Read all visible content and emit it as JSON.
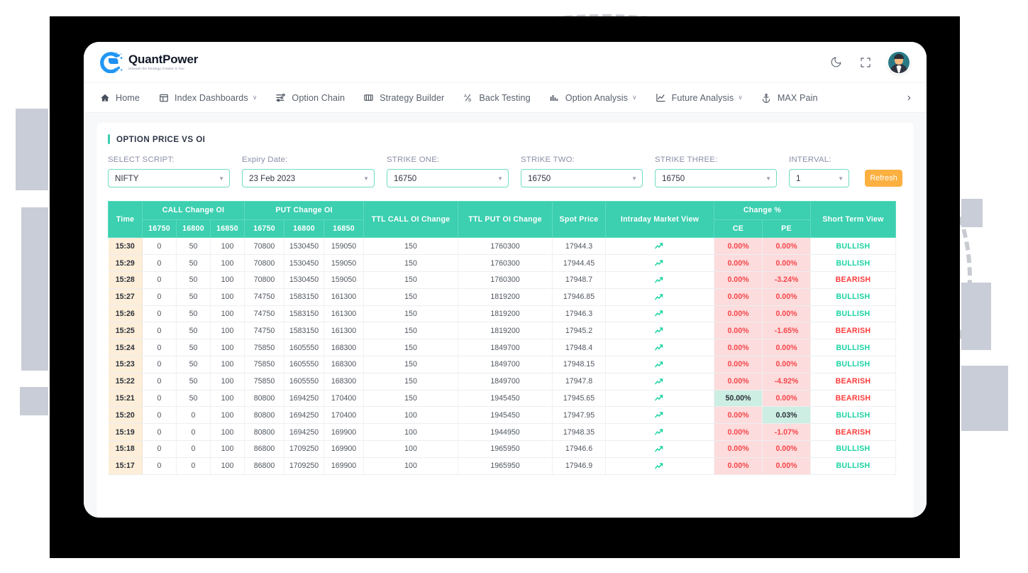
{
  "brand": {
    "name": "QuantPower",
    "tagline": "Unleash the Strategy Creator in You"
  },
  "top_actions": [
    {
      "name": "dark-mode-toggle",
      "icon": "moon-icon"
    },
    {
      "name": "fullscreen-button",
      "icon": "fullscreen-icon"
    },
    {
      "name": "user-avatar",
      "icon": "avatar-icon"
    }
  ],
  "nav": {
    "items": [
      {
        "label": "Home",
        "icon": "home-icon",
        "caret": ""
      },
      {
        "label": "Index Dashboards",
        "icon": "dashboard-icon",
        "caret": "∨"
      },
      {
        "label": "Option Chain",
        "icon": "option-chain-icon",
        "caret": ""
      },
      {
        "label": "Strategy Builder",
        "icon": "strategy-icon",
        "caret": ""
      },
      {
        "label": "Back Testing",
        "icon": "backtesting-icon",
        "caret": ""
      },
      {
        "label": "Option Analysis",
        "icon": "bar-chart-icon",
        "caret": "∨"
      },
      {
        "label": "Future Analysis",
        "icon": "line-chart-icon",
        "caret": "∨"
      },
      {
        "label": "MAX Pain",
        "icon": "anchor-icon",
        "caret": ""
      }
    ],
    "more": "›"
  },
  "panel": {
    "title": "OPTION PRICE VS OI",
    "accent_color": "#3ccfb0"
  },
  "filters": {
    "fields": [
      {
        "name": "select-script",
        "label": "SELECT SCRIPT:",
        "value": "NIFTY"
      },
      {
        "name": "expiry-date",
        "label": "Expiry Date:",
        "value": "23 Feb 2023"
      },
      {
        "name": "strike-one",
        "label": "STRIKE ONE:",
        "value": "16750"
      },
      {
        "name": "strike-two",
        "label": "STRIKE TWO:",
        "value": "16750"
      },
      {
        "name": "strike-three",
        "label": "STRIKE THREE:",
        "value": "16750"
      },
      {
        "name": "interval",
        "label": "INTERVAL:",
        "value": "1"
      }
    ],
    "refresh_label": "Refresh",
    "refresh_color": "#fbb040"
  },
  "table": {
    "group_headers": {
      "time": "Time",
      "call_change_oi": "CALL Change OI",
      "put_change_oi": "PUT Change OI",
      "ttl_call_oi_change": "TTL CALL OI Change",
      "ttl_put_oi_change": "TTL PUT OI Change",
      "spot_price": "Spot Price",
      "intraday_market_view": "Intraday Market View",
      "change_pct": "Change %",
      "short_term_view": "Short Term View"
    },
    "sub_headers": {
      "call_strikes": [
        "16750",
        "16800",
        "16850"
      ],
      "put_strikes": [
        "16750",
        "16800",
        "16850"
      ],
      "change_pct": [
        "CE",
        "PE"
      ]
    },
    "rows": [
      {
        "time": "15:30",
        "call": [
          "0",
          "50",
          "100"
        ],
        "put": [
          "70800",
          "1530450",
          "159050"
        ],
        "ttl_call": "150",
        "ttl_put": "1760300",
        "spot": "17944.3",
        "trend": "up",
        "ce": "0.00%",
        "ce_pos": false,
        "pe": "0.00%",
        "pe_pos": false,
        "stv": "BULLISH"
      },
      {
        "time": "15:29",
        "call": [
          "0",
          "50",
          "100"
        ],
        "put": [
          "70800",
          "1530450",
          "159050"
        ],
        "ttl_call": "150",
        "ttl_put": "1760300",
        "spot": "17944.45",
        "trend": "up",
        "ce": "0.00%",
        "ce_pos": false,
        "pe": "0.00%",
        "pe_pos": false,
        "stv": "BULLISH"
      },
      {
        "time": "15:28",
        "call": [
          "0",
          "50",
          "100"
        ],
        "put": [
          "70800",
          "1530450",
          "159050"
        ],
        "ttl_call": "150",
        "ttl_put": "1760300",
        "spot": "17948.7",
        "trend": "up",
        "ce": "0.00%",
        "ce_pos": false,
        "pe": "-3.24%",
        "pe_pos": false,
        "stv": "BEARISH"
      },
      {
        "time": "15:27",
        "call": [
          "0",
          "50",
          "100"
        ],
        "put": [
          "74750",
          "1583150",
          "161300"
        ],
        "ttl_call": "150",
        "ttl_put": "1819200",
        "spot": "17946.85",
        "trend": "up",
        "ce": "0.00%",
        "ce_pos": false,
        "pe": "0.00%",
        "pe_pos": false,
        "stv": "BULLISH"
      },
      {
        "time": "15:26",
        "call": [
          "0",
          "50",
          "100"
        ],
        "put": [
          "74750",
          "1583150",
          "161300"
        ],
        "ttl_call": "150",
        "ttl_put": "1819200",
        "spot": "17946.3",
        "trend": "up",
        "ce": "0.00%",
        "ce_pos": false,
        "pe": "0.00%",
        "pe_pos": false,
        "stv": "BULLISH"
      },
      {
        "time": "15:25",
        "call": [
          "0",
          "50",
          "100"
        ],
        "put": [
          "74750",
          "1583150",
          "161300"
        ],
        "ttl_call": "150",
        "ttl_put": "1819200",
        "spot": "17945.2",
        "trend": "up",
        "ce": "0.00%",
        "ce_pos": false,
        "pe": "-1.65%",
        "pe_pos": false,
        "stv": "BEARISH"
      },
      {
        "time": "15:24",
        "call": [
          "0",
          "50",
          "100"
        ],
        "put": [
          "75850",
          "1605550",
          "168300"
        ],
        "ttl_call": "150",
        "ttl_put": "1849700",
        "spot": "17948.4",
        "trend": "up",
        "ce": "0.00%",
        "ce_pos": false,
        "pe": "0.00%",
        "pe_pos": false,
        "stv": "BULLISH"
      },
      {
        "time": "15:23",
        "call": [
          "0",
          "50",
          "100"
        ],
        "put": [
          "75850",
          "1605550",
          "168300"
        ],
        "ttl_call": "150",
        "ttl_put": "1849700",
        "spot": "17948.15",
        "trend": "up",
        "ce": "0.00%",
        "ce_pos": false,
        "pe": "0.00%",
        "pe_pos": false,
        "stv": "BULLISH"
      },
      {
        "time": "15:22",
        "call": [
          "0",
          "50",
          "100"
        ],
        "put": [
          "75850",
          "1605550",
          "168300"
        ],
        "ttl_call": "150",
        "ttl_put": "1849700",
        "spot": "17947.8",
        "trend": "up",
        "ce": "0.00%",
        "ce_pos": false,
        "pe": "-4.92%",
        "pe_pos": false,
        "stv": "BEARISH"
      },
      {
        "time": "15:21",
        "call": [
          "0",
          "50",
          "100"
        ],
        "put": [
          "80800",
          "1694250",
          "170400"
        ],
        "ttl_call": "150",
        "ttl_put": "1945450",
        "spot": "17945.65",
        "trend": "up",
        "ce": "50.00%",
        "ce_pos": true,
        "pe": "0.00%",
        "pe_pos": false,
        "stv": "BEARISH"
      },
      {
        "time": "15:20",
        "call": [
          "0",
          "0",
          "100"
        ],
        "put": [
          "80800",
          "1694250",
          "170400"
        ],
        "ttl_call": "100",
        "ttl_put": "1945450",
        "spot": "17947.95",
        "trend": "up",
        "ce": "0.00%",
        "ce_pos": false,
        "pe": "0.03%",
        "pe_pos": true,
        "stv": "BULLISH"
      },
      {
        "time": "15:19",
        "call": [
          "0",
          "0",
          "100"
        ],
        "put": [
          "80800",
          "1694250",
          "169900"
        ],
        "ttl_call": "100",
        "ttl_put": "1944950",
        "spot": "17948.35",
        "trend": "up",
        "ce": "0.00%",
        "ce_pos": false,
        "pe": "-1.07%",
        "pe_pos": false,
        "stv": "BEARISH"
      },
      {
        "time": "15:18",
        "call": [
          "0",
          "0",
          "100"
        ],
        "put": [
          "86800",
          "1709250",
          "169900"
        ],
        "ttl_call": "100",
        "ttl_put": "1965950",
        "spot": "17946.6",
        "trend": "up",
        "ce": "0.00%",
        "ce_pos": false,
        "pe": "0.00%",
        "pe_pos": false,
        "stv": "BULLISH"
      },
      {
        "time": "15:17",
        "call": [
          "0",
          "0",
          "100"
        ],
        "put": [
          "86800",
          "1709250",
          "169900"
        ],
        "ttl_call": "100",
        "ttl_put": "1965950",
        "spot": "17946.9",
        "trend": "up",
        "ce": "0.00%",
        "ce_pos": false,
        "pe": "0.00%",
        "pe_pos": false,
        "stv": "BULLISH"
      }
    ]
  },
  "colors": {
    "header_teal": "#3ccfb0",
    "time_cell": "#fdeed9",
    "negative_bg": "#fcdcdc",
    "negative_text": "#f5464c",
    "positive_bg": "#cdeee2",
    "bullish": "#19d3a2",
    "bearish": "#fb3b3b",
    "refresh": "#fbb040"
  }
}
